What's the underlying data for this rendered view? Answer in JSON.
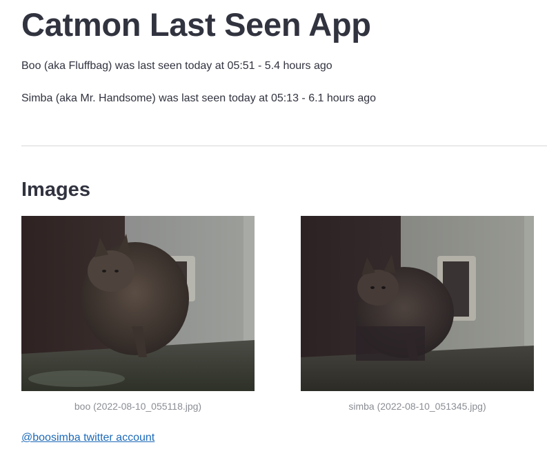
{
  "header": {
    "title": "Catmon Last Seen App"
  },
  "status": [
    {
      "text": "Boo (aka Fluffbag) was last seen today at 05:51 - 5.4 hours ago"
    },
    {
      "text": "Simba (aka Mr. Handsome) was last seen today at 05:13 - 6.1 hours ago"
    }
  ],
  "images_section": {
    "heading": "Images",
    "items": [
      {
        "caption": "boo (2022-08-10_055118.jpg)",
        "alt": "Boo",
        "icon": "cat-photo"
      },
      {
        "caption": "simba (2022-08-10_051345.jpg)",
        "alt": "Simba",
        "icon": "cat-photo"
      }
    ]
  },
  "footer": {
    "link_text": "@boosimba twitter account"
  },
  "colors": {
    "text": "#31333f",
    "caption": "#8a8d93",
    "link": "#1c69b8",
    "divider": "#d6d6d9"
  }
}
